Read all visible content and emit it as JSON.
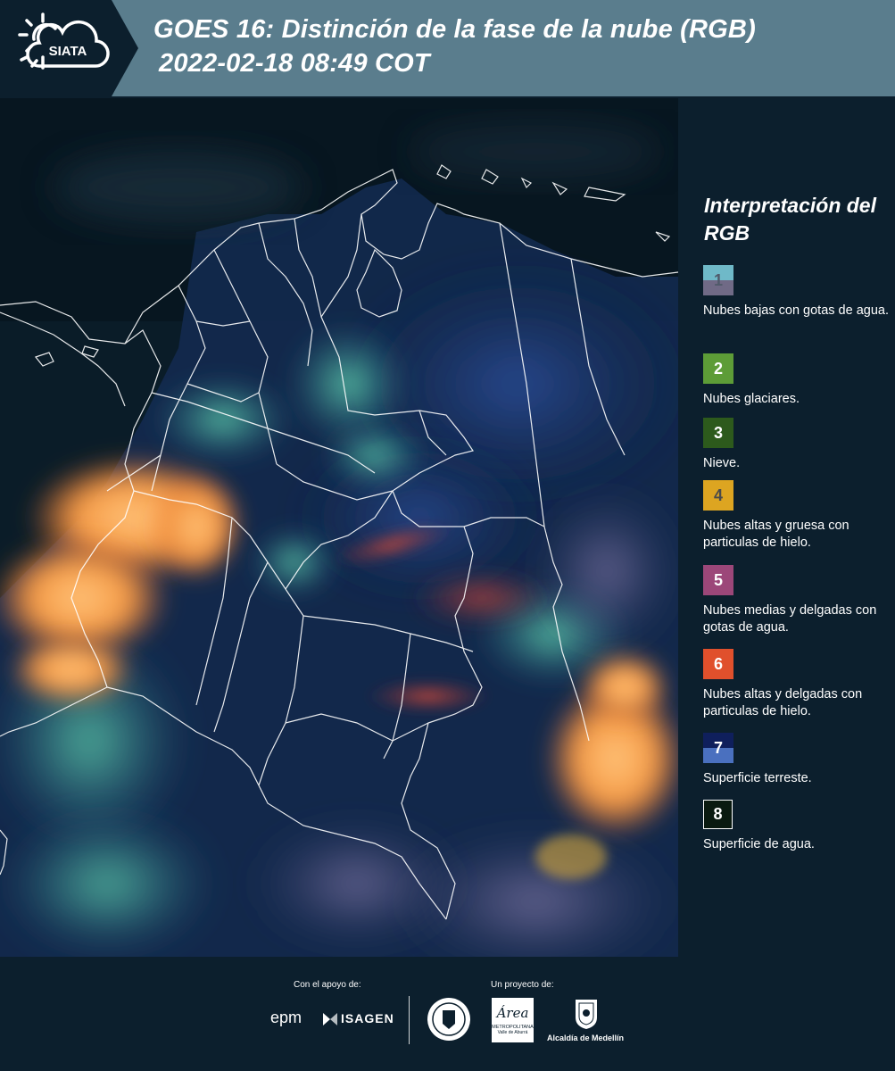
{
  "header": {
    "title_line1": "GOES 16: Distinción de la fase de la nube (RGB)",
    "title_line2": "2022-02-18 08:49 COT",
    "logo_text": "SIATA"
  },
  "legend": {
    "title": "Interpretación del RGB",
    "items": [
      {
        "number": "1",
        "label": "Nubes bajas con gotas de agua.",
        "color_top": "#6fb9c8",
        "color_bottom": "#706a86"
      },
      {
        "number": "2",
        "label": "Nubes glaciares.",
        "color": "#5d9c37"
      },
      {
        "number": "3",
        "label": "Nieve.",
        "color": "#2d5a1c"
      },
      {
        "number": "4",
        "label": "Nubes altas y gruesa con particulas de hielo.",
        "color": "#dda521"
      },
      {
        "number": "5",
        "label": "Nubes medias y delgadas con gotas de agua.",
        "color": "#9c4779"
      },
      {
        "number": "6",
        "label": "Nubes altas y delgadas con particulas de hielo.",
        "color": "#e0502c"
      },
      {
        "number": "7",
        "label": "Superficie terreste.",
        "color_top": "#0f1f5c",
        "color_bottom": "#4a70bf"
      },
      {
        "number": "8",
        "label": "Superficie de agua.",
        "color": "#0a1a10"
      }
    ]
  },
  "footer": {
    "support_label": "Con el apoyo de:",
    "project_label": "Un proyecto de:",
    "sponsors": [
      "epm",
      "ISAGEN"
    ],
    "partners": [
      "Área Metropolitana Valle de Aburrá",
      "Alcaldía de Medellín"
    ],
    "epm_text": "epm",
    "isagen_text": "ISAGEN",
    "area_text": "Área",
    "area_sub": "METROPOLITANA",
    "area_sub2": "Valle de Aburrá",
    "alcaldia_text": "Alcaldía de Medellín"
  },
  "colors": {
    "header_bg": "#5a7d8d",
    "page_bg": "#0c1f2d",
    "cloud_orange": "#f59a45",
    "cloud_teal": "#4fb7a4"
  }
}
